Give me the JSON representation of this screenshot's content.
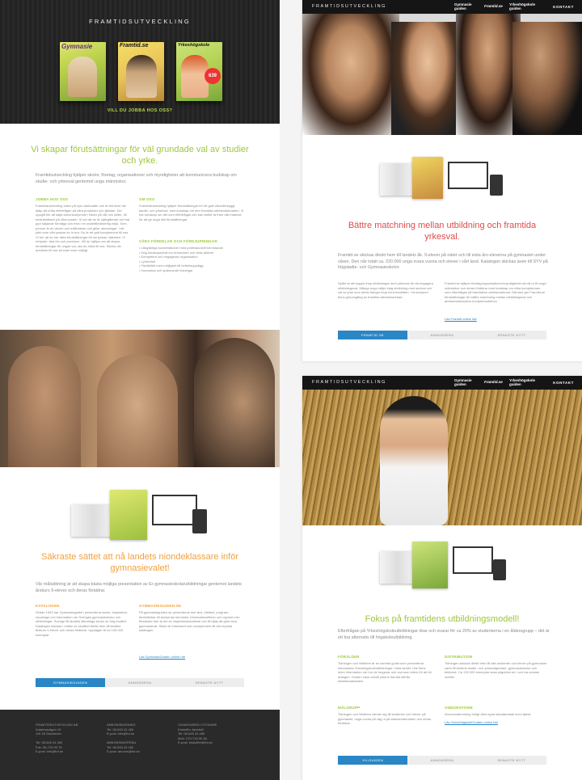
{
  "brand_name": "FRAMTIDSUTVECKLING",
  "colors": {
    "green": "#9bc83a",
    "orange": "#f0a040",
    "red": "#e14a4a",
    "blue": "#2a86c4",
    "dark": "#222222"
  },
  "left": {
    "magazines": [
      "Gymnasie",
      "Framtid.se",
      "Yrkeshögskole"
    ],
    "cta": "VILL DU JOBBA HOS OSS?",
    "headline": "Vi skapar förutsättningar för väl grundade val av studier och yrke.",
    "lede": "Framtidsutveckling hjälper skolor, företag, organisationer och myndigheter att kommunicera budskap om studie- och yrkesval gentemot unga människor.",
    "col1_heading": "JOBBA HOS OSS",
    "col1_text": "Framtidsutveckling söker på nya marknader och är behöver din hjälp att möta efterfrågan på våra produkter och tjänster. Din uppgift blir att sälja annonsutrymme i bilder på vår och webb, till beslutsfattare på våra kunder. Vi ser att du är självgående och har god säljande förmåga och trivs i en snabbföränderlig miljö. Som person är du driven och målinriktad och gillar utmaningar. I ett jobb som vårt passar du in bra. Du är ett gott komplement till oss. Vi tror att du har rätta förutsättningar för att lyckas i tjänsten. Vi erbjuder: fast lön och provision. Vill du hjälpa oss att skapa förutsättningar för ungas val, ska du söka till oss. Skicka din ansökan till oss så snart som möjligt.",
    "col2_heading": "OM OSS",
    "col2_text": "Framtidsutveckling hjälper förutsättningar för ett gott välunderbyggt studie- och yrkesval, med kunskap om den framtida arbetsmarknaden. Vi har kunskap om det som efterfrågas och kan därför ta fram rätt material för att ge unga rätt förutsättningar.",
    "col2_sub": "VÅRA FÖRDELAR OCH FÖRDJUPNINGAR",
    "col2_bullets": [
      "• Långsiktiga kundrelationer med professionellt bemötande",
      "• Hög kunskapsnivå om branschen och dess aktörer",
      "• Kompetent och engagerad organisation",
      "• Lyhördhet",
      "• Flexibilitet med möjlighet till helhetsupplägg",
      "• Innovativa och spännande lösningar"
    ],
    "headline2": "Säkraste sättet att nå landets niondeklassare inför gymnasievalet!",
    "lede2": "Vår målsättning är att skapa bästa möjliga presentation av Er gymnasieskola/utbildningar gentemot landets årskurs 9-elever och deras föräldrar.",
    "col3_heading": "KATALOGEN",
    "col3_text": "Sedan 1993 har Gymnasieguiden presenterat skolor, inspiration, reportage och information om Sveriges gymnasieskolor och utbildningar. Sverige till landets åtkomliga skolor av hög kvalitet. Katalogen skickas i mitten av skolåret direkt hem till landets årskurs 9-elever och deras föräldrar. Upplagan är ca 130.000 exemplar.",
    "col4_heading": "GYMNASIEGUIDEN.SE",
    "col4_text": "På gymnasieguiden.se presenteras mer text, bildtext, program, direktlänkar till skolornas hemsidor, informationsfilmer och mycket mer. Besökare kan ta del av inspirationsmaterial och få hjälp att göra sina gymnasieval. Sidan är intressant som komplement till den tryckta katalogen.",
    "link": "Läs GymnasieGuiden online här",
    "tabs": [
      "GYMNASIEGUIDEN",
      "ANNONSERA",
      "SENASTE NYTT"
    ],
    "footer": [
      {
        "lines": [
          "FRAMTIDSUTVECKLING AB",
          "Katarinavägen 19",
          "116 45 Stockholm",
          "",
          "Tel: 08-545 43 450",
          "Fax: 08-729 93 75",
          "E-post: info@fut.se"
        ]
      },
      {
        "lines": [
          "ANNONSBOKNING",
          "Tel: 08-545 43 450",
          "E-post: info@fut.se",
          "",
          "ANNONSMATERIAL",
          "Tel: 08-545 43 450",
          "E-post: annons@fut.se"
        ]
      },
      {
        "lines": [
          "VD/ANSVARIG UTGIVARE",
          "Kristoffer Janetelli",
          "Tel: 08-545 43 455",
          "Mob: 070-715 90 46",
          "E-post: kristoffer@fut.se"
        ]
      }
    ]
  },
  "right_top": {
    "nav_items": [
      "Gymnasie guiden",
      "Framtid.se",
      "Yrkeshögskole guiden",
      "KONTAKT"
    ],
    "headline": "Bättre matchning mellan utbildning och framtida yrkesval.",
    "lede": "Framtid.se skickas direkt hem till landets åk. 9-elever på nätet och till sista års-eleverna på gymnasiet under våren. Den når totalt ca. 220 000 unga svara vuxna och elever i vårt land. Katalogen skickas även till SYV på högstadie- och Gymnasieskolor.",
    "col1_text": "Syftet är att koppla ihop utbildningar med yrkesval för att engagera utbildningsval. Många unga väljer idag utbildning med skolval och val av yrke som direkt hänger ihop med framtiden. I broschyren finns genomgång av framtida arbetsmarknad.",
    "col2_text": "Framtid.se hjälper företag/organisationer/myndigheter att nå ut till unga människor och deras föräldrar med budskap om vilka kompetenser som efterfrågas på framtidens arbetsmarknad. Därmed ger Framtid.se förutsättningar för bättre matchning mellan utbildningsval och arbetsmarknadens kompetensbehov.",
    "link": "Läs Framtid online här",
    "tabs": [
      "FRAMTID.SE",
      "ANNONSERA",
      "SENASTE NYTT"
    ]
  },
  "right_bottom": {
    "nav_items": [
      "Gymnasie guiden",
      "Framtid.se",
      "Yrkeshögskole guiden",
      "KONTAKT"
    ],
    "headline": "Fokus på framtidens utbildningsmodell!",
    "lede": "Efterfrågan på Yrkeshögskoleutbildningar ökar och svarar för ca 20% av studenterna i en åldersgrupp – det är ett bra alternativ till högskoleutbildning.",
    "col1_heading": "FÖRÄLDER",
    "col1_text": "Tidningen och Webben är en samlad guide som presenterar intressanta Yrkeshögskoleutbildningar i hela landet. Här finns även information om hur de fungerar och vad som krävs för att bli antagen. Guiden visar också yrkens framtid utifrån arbetsmarknaden.",
    "col1_sub": "MÅLGRUPP",
    "col1_text2": "Tidningen och Webben vänder sig till studenter och elever på gymnasiet, unga vuxna på väg ut på arbetsmarknaden och deras föräldrar.",
    "col2_heading": "DISTRIBUTION",
    "col2_text": "Tidningen skickas direkt hem till alla studenter och elever på gymnasiet samt till landets studie- och yrkesvägledare, gymnasieskolor och bibliotek. Ca 130 000 exemplar www.yhguiden.se i och via sociala medier.",
    "col2_sub": "ANNONSFORM",
    "col2_text2": "Annonsutformning enligt våra egna standardmall inom tjänst.",
    "link": "Läs YrkesHögskoleGuiden online här",
    "tabs": [
      "YH-GUIDEN",
      "ANNONSERA",
      "SENASTE NYTT"
    ]
  }
}
